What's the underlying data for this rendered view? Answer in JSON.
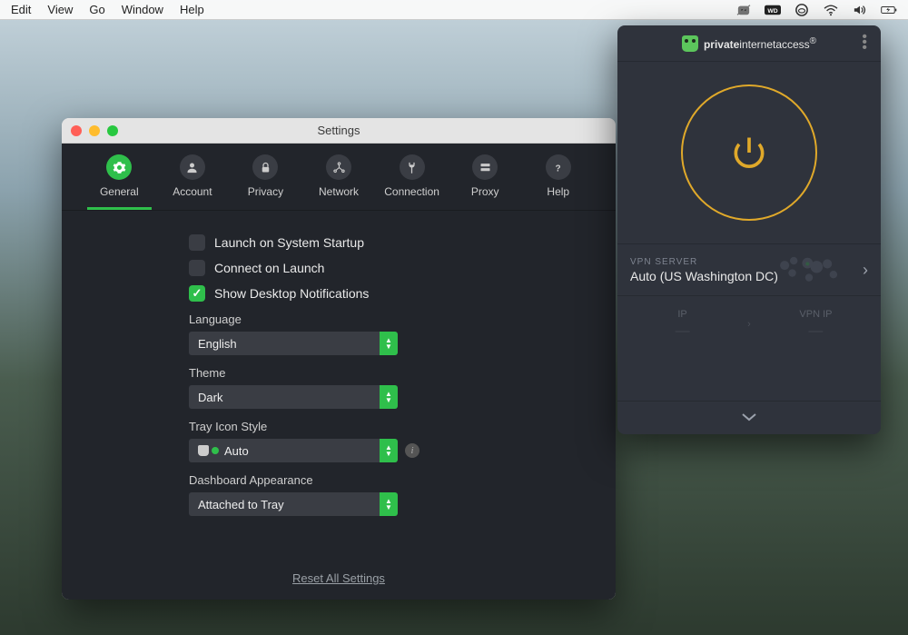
{
  "menubar": {
    "items": [
      "Edit",
      "View",
      "Go",
      "Window",
      "Help"
    ]
  },
  "settings": {
    "title": "Settings",
    "tabs": [
      {
        "id": "general",
        "label": "General"
      },
      {
        "id": "account",
        "label": "Account"
      },
      {
        "id": "privacy",
        "label": "Privacy"
      },
      {
        "id": "network",
        "label": "Network"
      },
      {
        "id": "connection",
        "label": "Connection"
      },
      {
        "id": "proxy",
        "label": "Proxy"
      },
      {
        "id": "help",
        "label": "Help"
      }
    ],
    "active_tab": "general",
    "checks": {
      "launch_startup": {
        "label": "Launch on System Startup",
        "checked": false
      },
      "connect_launch": {
        "label": "Connect on Launch",
        "checked": false
      },
      "desktop_notifications": {
        "label": "Show Desktop Notifications",
        "checked": true
      }
    },
    "fields": {
      "language": {
        "label": "Language",
        "value": "English"
      },
      "theme": {
        "label": "Theme",
        "value": "Dark"
      },
      "tray_icon_style": {
        "label": "Tray Icon Style",
        "value": "Auto"
      },
      "dashboard_appearance": {
        "label": "Dashboard Appearance",
        "value": "Attached to Tray"
      }
    },
    "reset_link": "Reset All Settings"
  },
  "vpn": {
    "brand": {
      "private": "private",
      "rest": "internetaccess",
      "suffix": "®"
    },
    "server_label": "VPN SERVER",
    "server_value": "Auto (US Washington DC)",
    "ip_label": "IP",
    "vpn_ip_label": "VPN IP",
    "ip_value": "—",
    "vpn_ip_value": "—"
  }
}
